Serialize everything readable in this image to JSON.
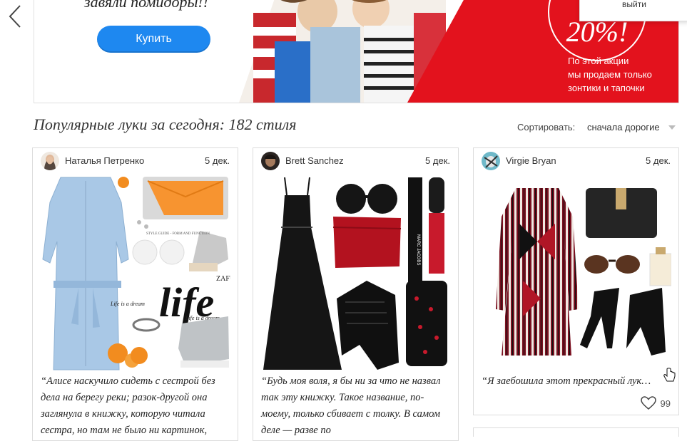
{
  "banner": {
    "headline": "завяли помидоры!!",
    "buy_label": "Купить",
    "promo_percent": "20%!",
    "promo_text": [
      "По этой акции",
      "мы продаем только",
      "зонтики и тапочки"
    ],
    "logout": "выйти"
  },
  "section": {
    "title": "Популярные луки за сегодня: 182 стиля",
    "sort_label": "Сортировать:",
    "sort_value": "сначала дорогие"
  },
  "cards": [
    {
      "author": "Наталья  Петренко",
      "date": "5 дек.",
      "quote": "“Алисе наскучило сидеть с сестрой без дела на берегу реки; разок-другой она заглянула в книжку, которую читала сестра, но там не было ни картинок,",
      "collage_texts": [
        "ZAFUL",
        "life",
        "Life is a dream",
        "Life is a dream"
      ]
    },
    {
      "author": "Brett Sanchez",
      "date": "5 дек.",
      "quote": "“Будь моя воля, я бы ни за что не назвал так эту книжку. Такое название, по-моему, только сбивает с толку. В самом деле — разве по",
      "collage_texts": [
        "MARC JACOBS"
      ]
    },
    {
      "author": "Virgie Bryan",
      "date": "5 дек.",
      "quote": "“Я заебошила этот прекрасный лук…",
      "likes": "99"
    }
  ]
}
